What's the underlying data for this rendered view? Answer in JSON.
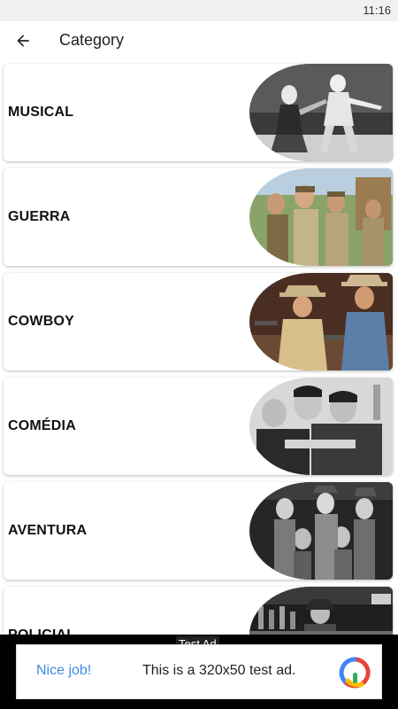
{
  "status_bar": {
    "time": "11:16"
  },
  "app_bar": {
    "title": "Category",
    "back_icon": "arrow-back-icon"
  },
  "categories": [
    {
      "label": "MUSICAL"
    },
    {
      "label": "GUERRA"
    },
    {
      "label": "COWBOY"
    },
    {
      "label": "COMÉDIA"
    },
    {
      "label": "AVENTURA"
    },
    {
      "label": "POLICIAL"
    }
  ],
  "ad": {
    "tag": "Test Ad",
    "cta": "Nice job!",
    "text": "This is a 320x50 test ad.",
    "logo_icon": "ad-logo-icon"
  },
  "colors": {
    "accent": "#3d8be4",
    "ad_background": "#000000",
    "status_bar": "#f1f1f1"
  }
}
